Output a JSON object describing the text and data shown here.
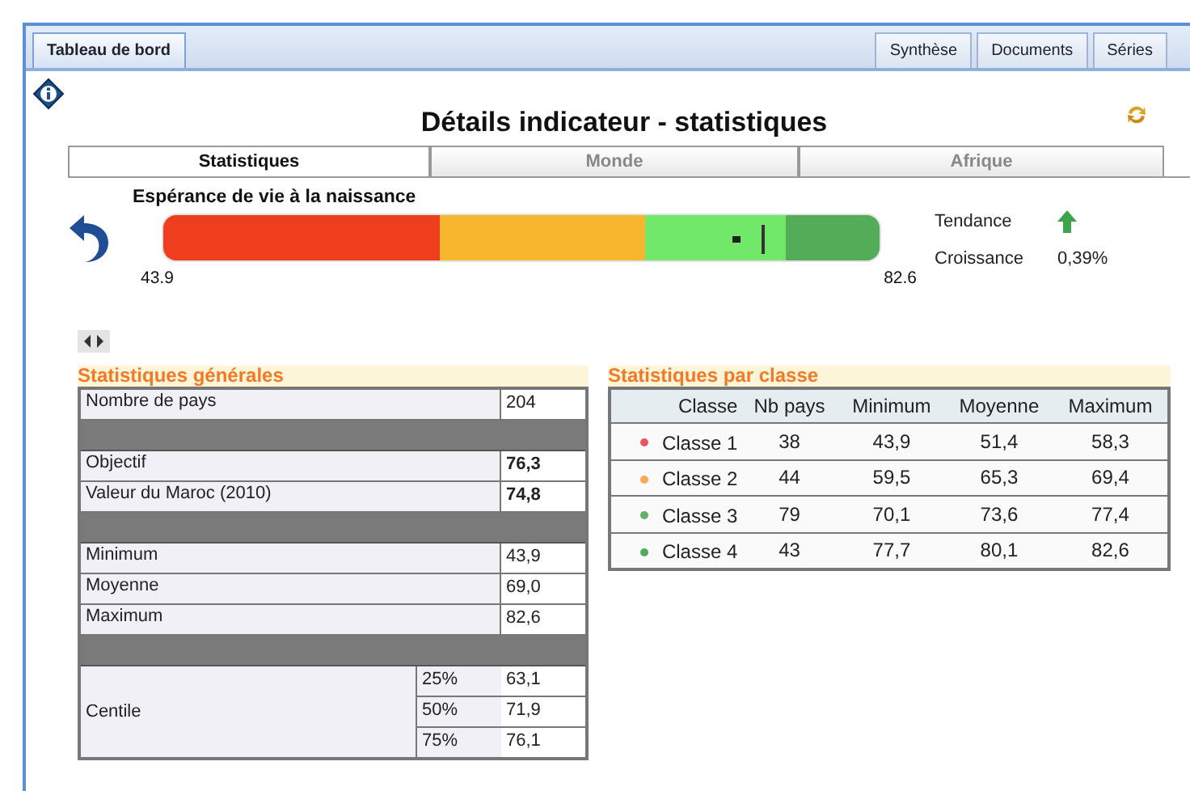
{
  "top_tabs": [
    {
      "label": "Tableau de bord",
      "selected": true
    },
    {
      "label": "Synthèse",
      "selected": false
    },
    {
      "label": "Documents",
      "selected": false
    },
    {
      "label": "Séries",
      "selected": false
    }
  ],
  "title": "Détails indicateur - statistiques",
  "sub_tabs": [
    {
      "label": "Statistiques",
      "selected": true
    },
    {
      "label": "Monde",
      "selected": false
    },
    {
      "label": "Afrique",
      "selected": false
    }
  ],
  "gauge": {
    "title": "Espérance de vie à la naissance",
    "min_label": "43.9",
    "max_label": "82.6",
    "segments": [
      {
        "color": "#ef3e1e"
      },
      {
        "color": "#f8b52e"
      },
      {
        "color": "#72e86a"
      },
      {
        "color": "#52ac58"
      }
    ],
    "value_marker": {
      "level": 0.8
    },
    "target_marker": {
      "level": 0.837
    }
  },
  "trend": {
    "label": "Tendance"
  },
  "growth": {
    "label": "Croissance",
    "value": "0,39%"
  },
  "general_stats": {
    "title": "Statistiques générales",
    "rows": [
      {
        "kind": "row",
        "label": "Nombre de pays",
        "value": "204",
        "bold": false
      },
      {
        "kind": "separator"
      },
      {
        "kind": "row",
        "label": "Objectif",
        "value": "76,3",
        "bold": true
      },
      {
        "kind": "row",
        "label": "Valeur du Maroc (2010)",
        "value": "74,8",
        "bold": true
      },
      {
        "kind": "separator"
      },
      {
        "kind": "row",
        "label": "Minimum",
        "value": "43,9",
        "bold": false
      },
      {
        "kind": "row",
        "label": "Moyenne",
        "value": "69,0",
        "bold": false
      },
      {
        "kind": "row",
        "label": "Maximum",
        "value": "82,6",
        "bold": false
      },
      {
        "kind": "separator"
      },
      {
        "kind": "group",
        "label": "Centile",
        "items": [
          {
            "label": "25%",
            "value": "63,1"
          },
          {
            "label": "50%",
            "value": "71,9"
          },
          {
            "label": "75%",
            "value": "76,1"
          }
        ]
      }
    ]
  },
  "class_stats": {
    "title": "Statistiques par classe",
    "columns": [
      "Classe",
      "Nb pays",
      "Minimum",
      "Moyenne",
      "Maximum"
    ],
    "rows": [
      {
        "color": "#e8575f",
        "cells": [
          "Classe 1",
          "38",
          "43,9",
          "51,4",
          "58,3"
        ]
      },
      {
        "color": "#f9a85a",
        "cells": [
          "Classe 2",
          "44",
          "59,5",
          "65,3",
          "69,4"
        ]
      },
      {
        "color": "#5cb364",
        "cells": [
          "Classe 3",
          "79",
          "70,1",
          "73,6",
          "77,4"
        ]
      },
      {
        "color": "#4fae5a",
        "cells": [
          "Classe 4",
          "43",
          "77,7",
          "80,1",
          "82,6"
        ]
      }
    ]
  }
}
